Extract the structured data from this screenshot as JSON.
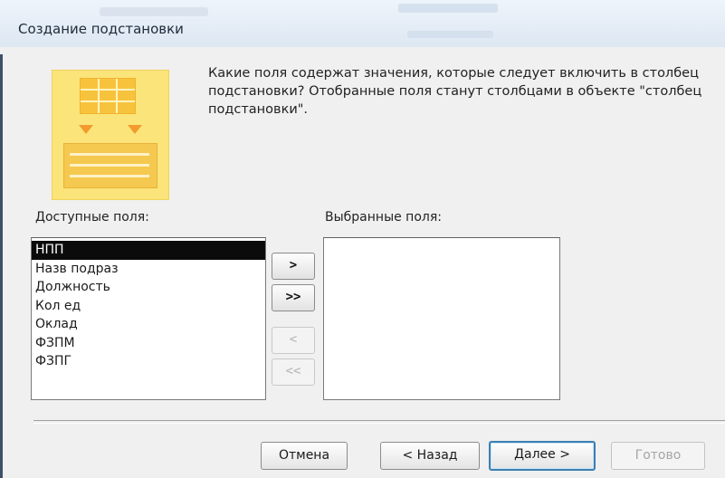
{
  "window": {
    "title": "Создание подстановки"
  },
  "wizard": {
    "icon": "lookup-wizard-icon",
    "question": "Какие поля содержат значения, которые следует включить в столбец подстановки? Отобранные поля станут столбцами в объекте \"столбец подстановки\"."
  },
  "available": {
    "label": "Доступные поля:",
    "items": [
      "НПП",
      "Назв подраз",
      "Должность",
      "Кол ед",
      "Оклад",
      "ФЗПМ",
      "ФЗПГ"
    ],
    "selected_index": 0
  },
  "selected": {
    "label": "Выбранные поля:",
    "items": []
  },
  "move_buttons": {
    "add_one": ">",
    "add_all": ">>",
    "remove_one": "<",
    "remove_all": "<<"
  },
  "footer": {
    "cancel": "Отмена",
    "back": "< Назад",
    "next": "Далее >",
    "finish": "Готово"
  }
}
